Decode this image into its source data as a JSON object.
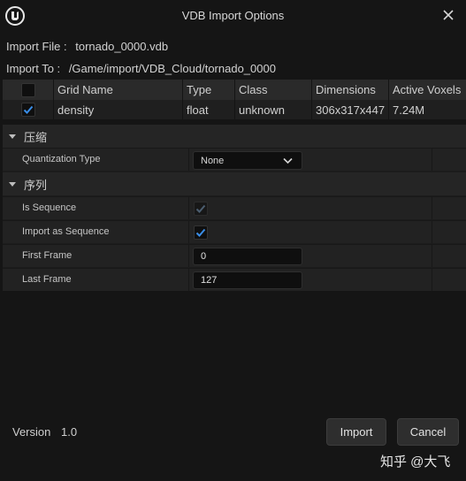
{
  "window": {
    "title": "VDB Import Options",
    "logo_icon": "unreal-engine-logo",
    "close_icon": "close-icon"
  },
  "info": {
    "import_file_label": "Import File :",
    "import_file_value": "tornado_0000.vdb",
    "import_to_label": "Import To :",
    "import_to_value": "/Game/import/VDB_Cloud/tornado_0000"
  },
  "grid_table": {
    "columns": [
      "",
      "Grid Name",
      "Type",
      "Class",
      "Dimensions",
      "Active Voxels"
    ],
    "header_checkbox_checked": false,
    "rows": [
      {
        "checked": true,
        "grid_name": "density",
        "type": "float",
        "class": "unknown",
        "dimensions": "306x317x447",
        "active_voxels": "7.24M"
      }
    ]
  },
  "sections": {
    "compression": {
      "title": "压缩",
      "quantization_label": "Quantization Type",
      "quantization_value": "None"
    },
    "sequence": {
      "title": "序列",
      "is_sequence_label": "Is Sequence",
      "is_sequence_checked": true,
      "is_sequence_enabled": false,
      "import_as_sequence_label": "Import as Sequence",
      "import_as_sequence_checked": true,
      "first_frame_label": "First Frame",
      "first_frame_value": "0",
      "last_frame_label": "Last Frame",
      "last_frame_value": "127"
    }
  },
  "footer": {
    "version_label": "Version",
    "version_value": "1.0",
    "import_label": "Import",
    "cancel_label": "Cancel"
  },
  "watermark": "知乎 @大飞",
  "colors": {
    "accent_check": "#3a8ee8",
    "background": "#151515"
  }
}
